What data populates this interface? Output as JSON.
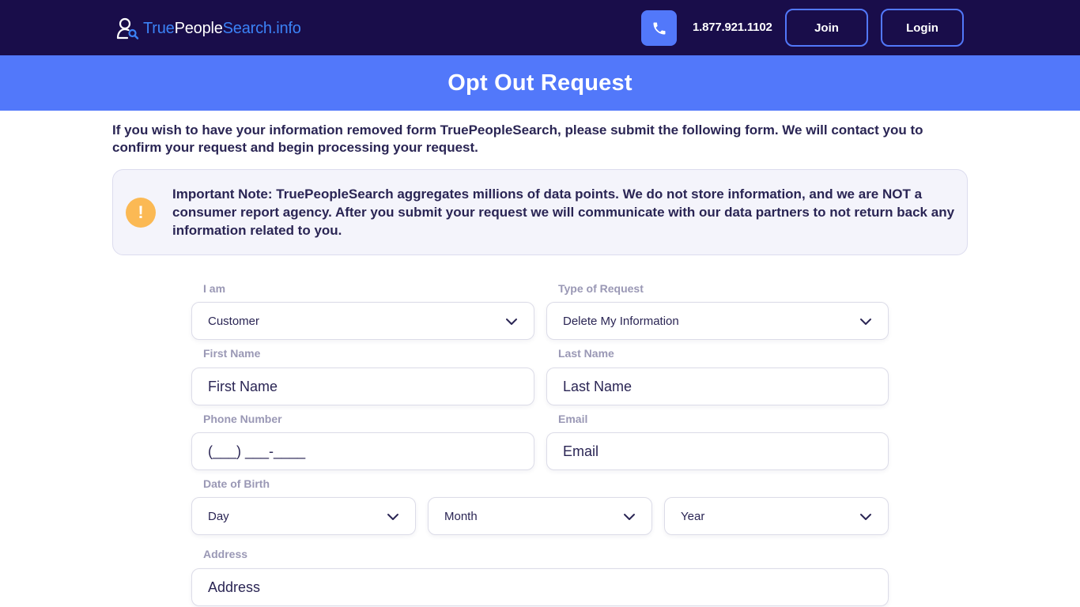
{
  "navbar": {
    "logo": {
      "part1": "True",
      "part2": "People",
      "part3": "Search.info"
    },
    "phone_number": "1.877.921.1102",
    "join_label": "Join",
    "login_label": "Login"
  },
  "hero": {
    "title": "Opt Out Request"
  },
  "intro": {
    "text": "If you wish to have your information removed form TruePeopleSearch, please submit the following form. We will contact you to confirm your request and begin processing your request."
  },
  "note": {
    "icon": "!",
    "text": "Important Note: TruePeopleSearch aggregates millions of data points. We do not store information, and we are NOT a consumer report agency. After you submit your request we will communicate with our data partners to not return back any information related to you."
  },
  "form": {
    "i_am": {
      "label": "I am",
      "value": "Customer"
    },
    "request_type": {
      "label": "Type of Request",
      "value": "Delete My Information"
    },
    "first_name": {
      "label": "First Name",
      "placeholder": "First Name",
      "value": ""
    },
    "last_name": {
      "label": "Last Name",
      "placeholder": "Last Name",
      "value": ""
    },
    "phone": {
      "label": "Phone Number",
      "placeholder": "(___) ___-____",
      "value": ""
    },
    "email": {
      "label": "Email",
      "placeholder": "Email",
      "value": ""
    },
    "dob": {
      "label": "Date of Birth",
      "day": "Day",
      "month": "Month",
      "year": "Year"
    },
    "address": {
      "label": "Address",
      "placeholder": "Address",
      "value": ""
    }
  },
  "colors": {
    "navbar_bg": "#190d4a",
    "accent": "#5278fa",
    "warning": "#fbb954",
    "text": "#2a2554",
    "label": "#9a98b5"
  },
  "icons": {
    "logo": "person-search-icon",
    "phone": "phone-icon",
    "warning": "exclamation-icon",
    "dropdown": "chevron-down-icon"
  }
}
